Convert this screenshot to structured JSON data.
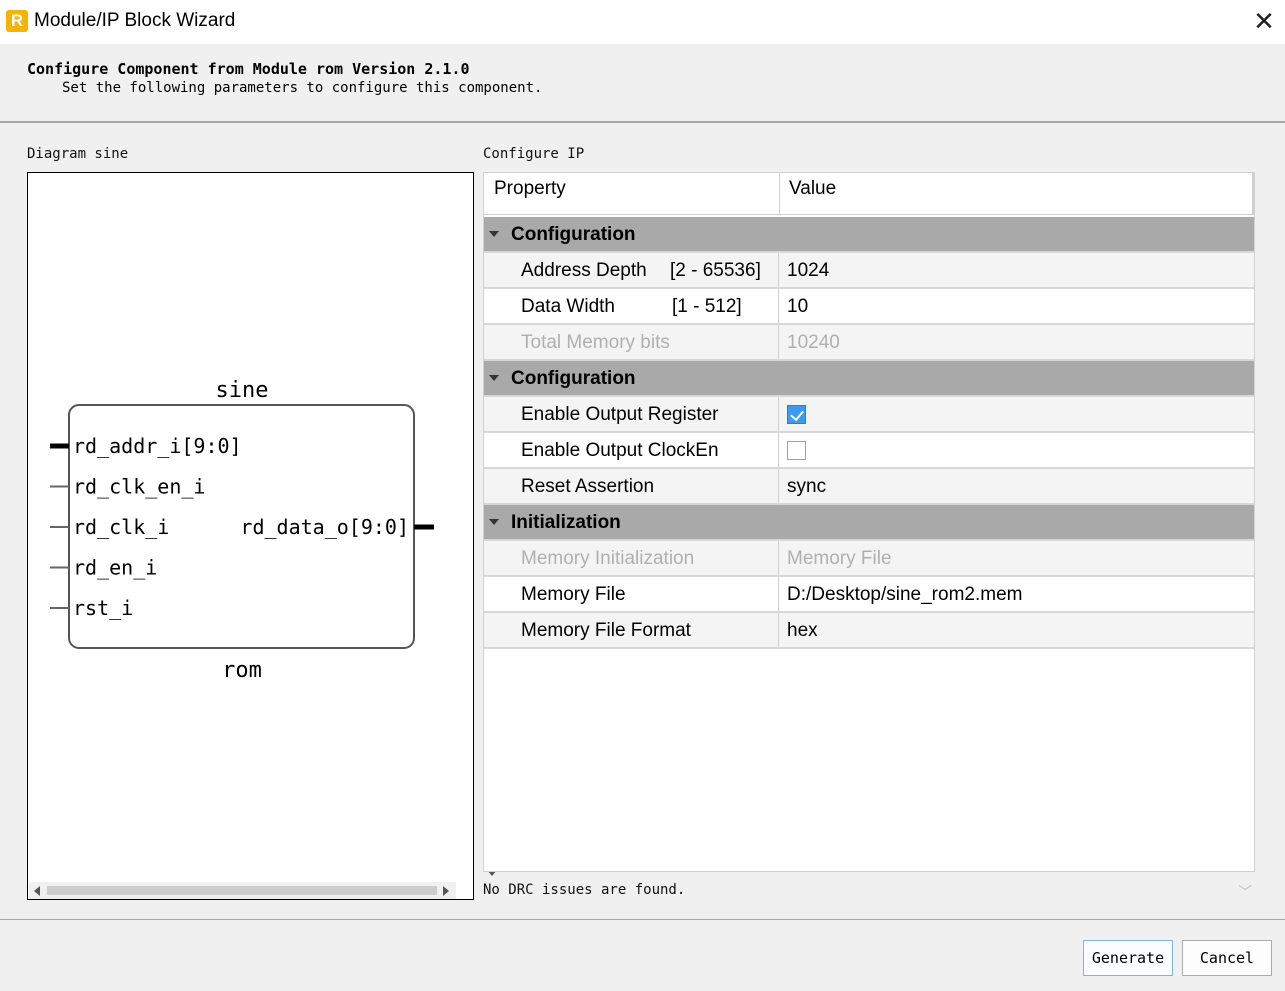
{
  "window": {
    "title": "Module/IP Block Wizard",
    "app_icon_letter": "R"
  },
  "header": {
    "title": "Configure Component from Module rom Version 2.1.0",
    "subtitle": "Set the following parameters to configure this component."
  },
  "diagram": {
    "label": "Diagram sine",
    "instance_name": "sine",
    "module_name": "rom",
    "inputs": [
      "rd_addr_i[9:0]",
      "rd_clk_en_i",
      "rd_clk_i",
      "rd_en_i",
      "rst_i"
    ],
    "outputs": [
      "rd_data_o[9:0]"
    ]
  },
  "config": {
    "label": "Configure IP",
    "columns": {
      "property": "Property",
      "value": "Value"
    },
    "rows": [
      {
        "kind": "group",
        "label": "Configuration"
      },
      {
        "kind": "prop",
        "name": "Address Depth",
        "range": "[2 - 65536]",
        "value": "1024",
        "disabled": false
      },
      {
        "kind": "prop",
        "name": "Data Width",
        "range": "[1 - 512]",
        "value": "10",
        "disabled": false
      },
      {
        "kind": "prop",
        "name": "Total Memory bits",
        "range": "",
        "value": "10240",
        "disabled": true
      },
      {
        "kind": "group",
        "label": "Configuration"
      },
      {
        "kind": "check",
        "name": "Enable Output Register",
        "checked": true
      },
      {
        "kind": "check",
        "name": "Enable Output ClockEn",
        "checked": false
      },
      {
        "kind": "prop",
        "name": "Reset Assertion",
        "range": "",
        "value": "sync",
        "disabled": false
      },
      {
        "kind": "group",
        "label": "Initialization"
      },
      {
        "kind": "prop",
        "name": "Memory Initialization",
        "range": "",
        "value": "Memory File",
        "disabled": true
      },
      {
        "kind": "prop",
        "name": "Memory File",
        "range": "",
        "value": "D:/Desktop/sine_rom2.mem",
        "disabled": false
      },
      {
        "kind": "prop",
        "name": "Memory File Format",
        "range": "",
        "value": "hex",
        "disabled": false
      }
    ]
  },
  "status": {
    "drc_message": "No DRC issues are found."
  },
  "buttons": {
    "generate": "Generate",
    "cancel": "Cancel"
  },
  "colors": {
    "group_header": "#a9a9a9",
    "checkbox_checked": "#3a9bf0",
    "disabled_text": "#b0b0b0"
  }
}
